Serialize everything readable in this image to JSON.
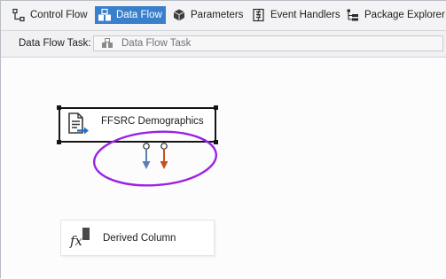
{
  "tabs": [
    {
      "label": "Control Flow",
      "icon": "control-flow-icon",
      "active": false
    },
    {
      "label": "Data Flow",
      "icon": "data-flow-icon",
      "active": true
    },
    {
      "label": "Parameters",
      "icon": "parameters-icon",
      "active": false
    },
    {
      "label": "Event Handlers",
      "icon": "event-handlers-icon",
      "active": false
    },
    {
      "label": "Package Explorer",
      "icon": "package-explorer-icon",
      "active": false
    }
  ],
  "task": {
    "label": "Data Flow Task:",
    "value": "Data Flow Task",
    "icon": "data-flow-task-icon"
  },
  "components": {
    "source": {
      "label": "FFSRC Demographics",
      "icon": "flat-file-source-icon",
      "selected": true
    },
    "derived": {
      "label": "Derived Column",
      "icon": "derived-column-icon",
      "selected": false
    }
  },
  "paths": {
    "data_output_color": "#5b7fb2",
    "error_output_color": "#c8501c"
  },
  "highlight": {
    "color": "#9b22e6"
  },
  "colors": {
    "accent": "#3a7fcb",
    "tab_active_text": "#ffffff"
  }
}
